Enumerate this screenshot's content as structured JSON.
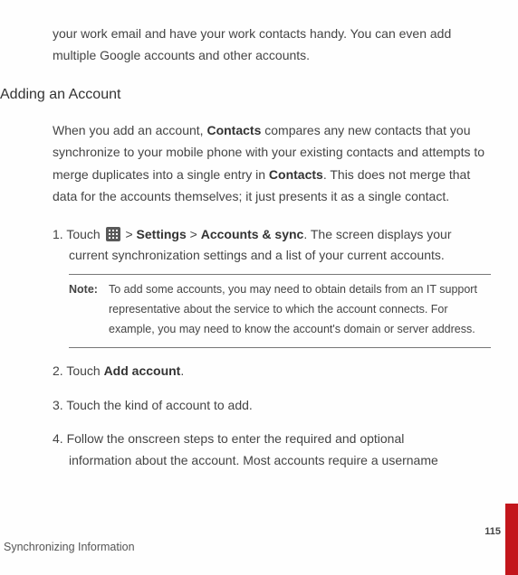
{
  "intro_continuation": "your work email and have your work contacts handy. You can even add multiple Google accounts and other accounts.",
  "section": {
    "heading": "Adding an Account",
    "intro_p1": "When you add an account, ",
    "intro_b1": "Contacts",
    "intro_p2": " compares any new contacts that you synchronize to your mobile phone with your existing contacts and attempts to merge duplicates into a single entry in ",
    "intro_b2": "Contacts",
    "intro_p3": ". This does not merge that data for the accounts themselves; it just presents it as a single contact."
  },
  "steps": {
    "s1": {
      "num": "1. ",
      "pre": "Touch ",
      "sep1": " > ",
      "bold1": "Settings",
      "sep2": " > ",
      "bold2": "Accounts & sync",
      "post": ". The screen displays your ",
      "cont": "current synchronization settings and a list of your current accounts.",
      "note_label": "Note:",
      "note_text": "To add some accounts, you may need to obtain details from an IT support representative about the service to which the account connects. For example, you may need to know the account's domain or server address."
    },
    "s2": {
      "num": "2. ",
      "pre": "Touch ",
      "bold": "Add account",
      "post": "."
    },
    "s3": {
      "num": "3. ",
      "text": "Touch the kind of account to add."
    },
    "s4": {
      "num": "4. ",
      "line1": "Follow the onscreen steps to enter the required and optional ",
      "cont": "information about the account. Most accounts require a username"
    }
  },
  "footer": "Synchronizing Information",
  "page_number": "115",
  "icon_name": "apps-grid-icon"
}
